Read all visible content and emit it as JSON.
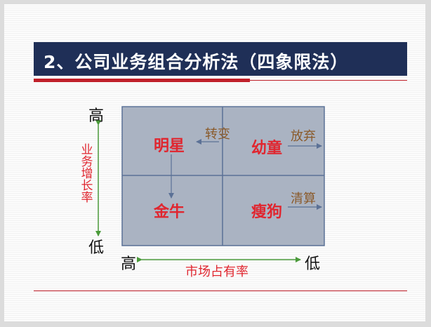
{
  "title": "2、公司业务组合分析法（四象限法）",
  "colors": {
    "title_bar": "#1f2f57",
    "accent_red": "#c0202a",
    "quadrant_fill": "#aab3c2",
    "quadrant_border": "#5b7196",
    "axis_green": "#4a9a3a",
    "label_red": "#e0262f",
    "move_brown": "#8a5a2a"
  },
  "diagram": {
    "y_axis": {
      "high": "高",
      "low": "低",
      "title": "业务增长率"
    },
    "x_axis": {
      "high": "高",
      "low": "低",
      "title": "市场占有率"
    },
    "quadrants": {
      "top_left": "明星",
      "top_right": "幼童",
      "bottom_left": "金牛",
      "bottom_right": "瘦狗"
    },
    "transitions": {
      "top": "转变",
      "top_right_exit": "放弃",
      "bottom_right_exit": "清算"
    }
  }
}
